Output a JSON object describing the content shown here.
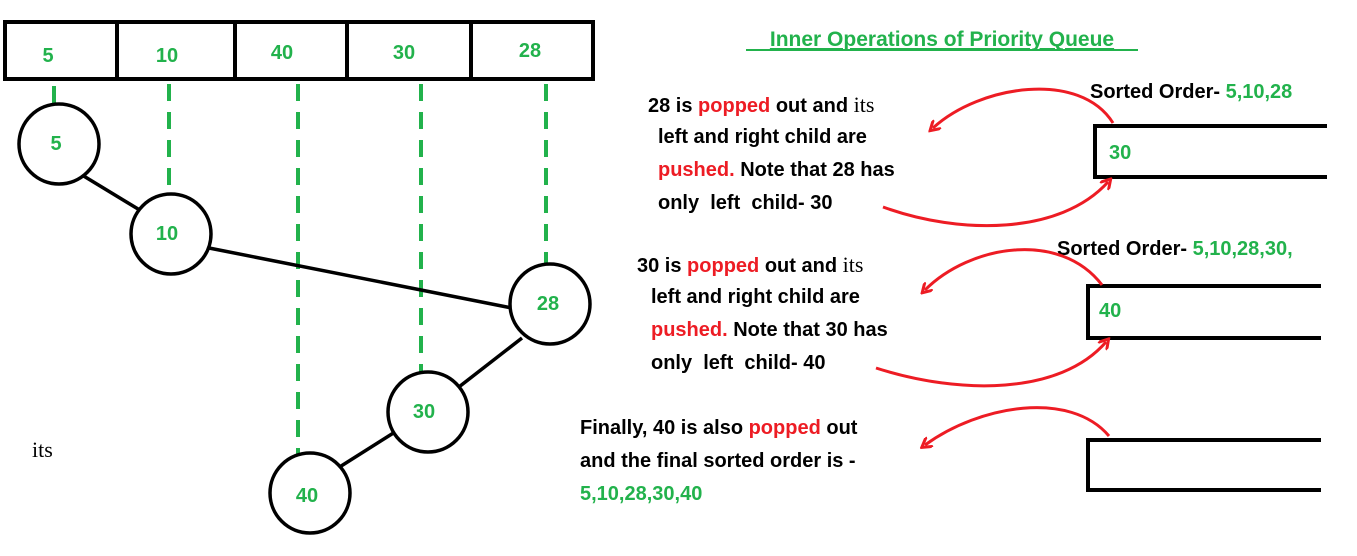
{
  "title": "Inner Operations of Priority Queue",
  "array": [
    "5",
    "10",
    "40",
    "30",
    "28"
  ],
  "nodes": [
    "5",
    "10",
    "28",
    "30",
    "40"
  ],
  "stray_label": "its",
  "colors": {
    "green": "#22b24c",
    "red": "#ed1c24",
    "black": "#000000"
  },
  "steps": [
    {
      "l1": {
        "a": "28 is ",
        "b": "popped",
        "c": " out and ",
        "d": "its"
      },
      "l2": "left and right child are",
      "l3": {
        "a": "pushed.",
        "b": " Note that 28 has"
      },
      "l4": "only  left  child- 30",
      "sorted_label": "Sorted Order- ",
      "sorted_value": "5,10,28",
      "box_value": "30"
    },
    {
      "l1": {
        "a": "30 is ",
        "b": "popped",
        "c": " out and ",
        "d": "its"
      },
      "l2": "left and right child are",
      "l3": {
        "a": "pushed.",
        "b": " Note that 30 has"
      },
      "l4": "only  left  child- 40",
      "sorted_label": "Sorted Order- ",
      "sorted_value": "5,10,28,30,",
      "box_value": "40"
    }
  ],
  "final": {
    "l1": {
      "a": "Finally, 40 is also ",
      "b": "popped",
      "c": " out"
    },
    "l2": "and the final sorted order is -",
    "l3": "5,10,28,30,40"
  }
}
